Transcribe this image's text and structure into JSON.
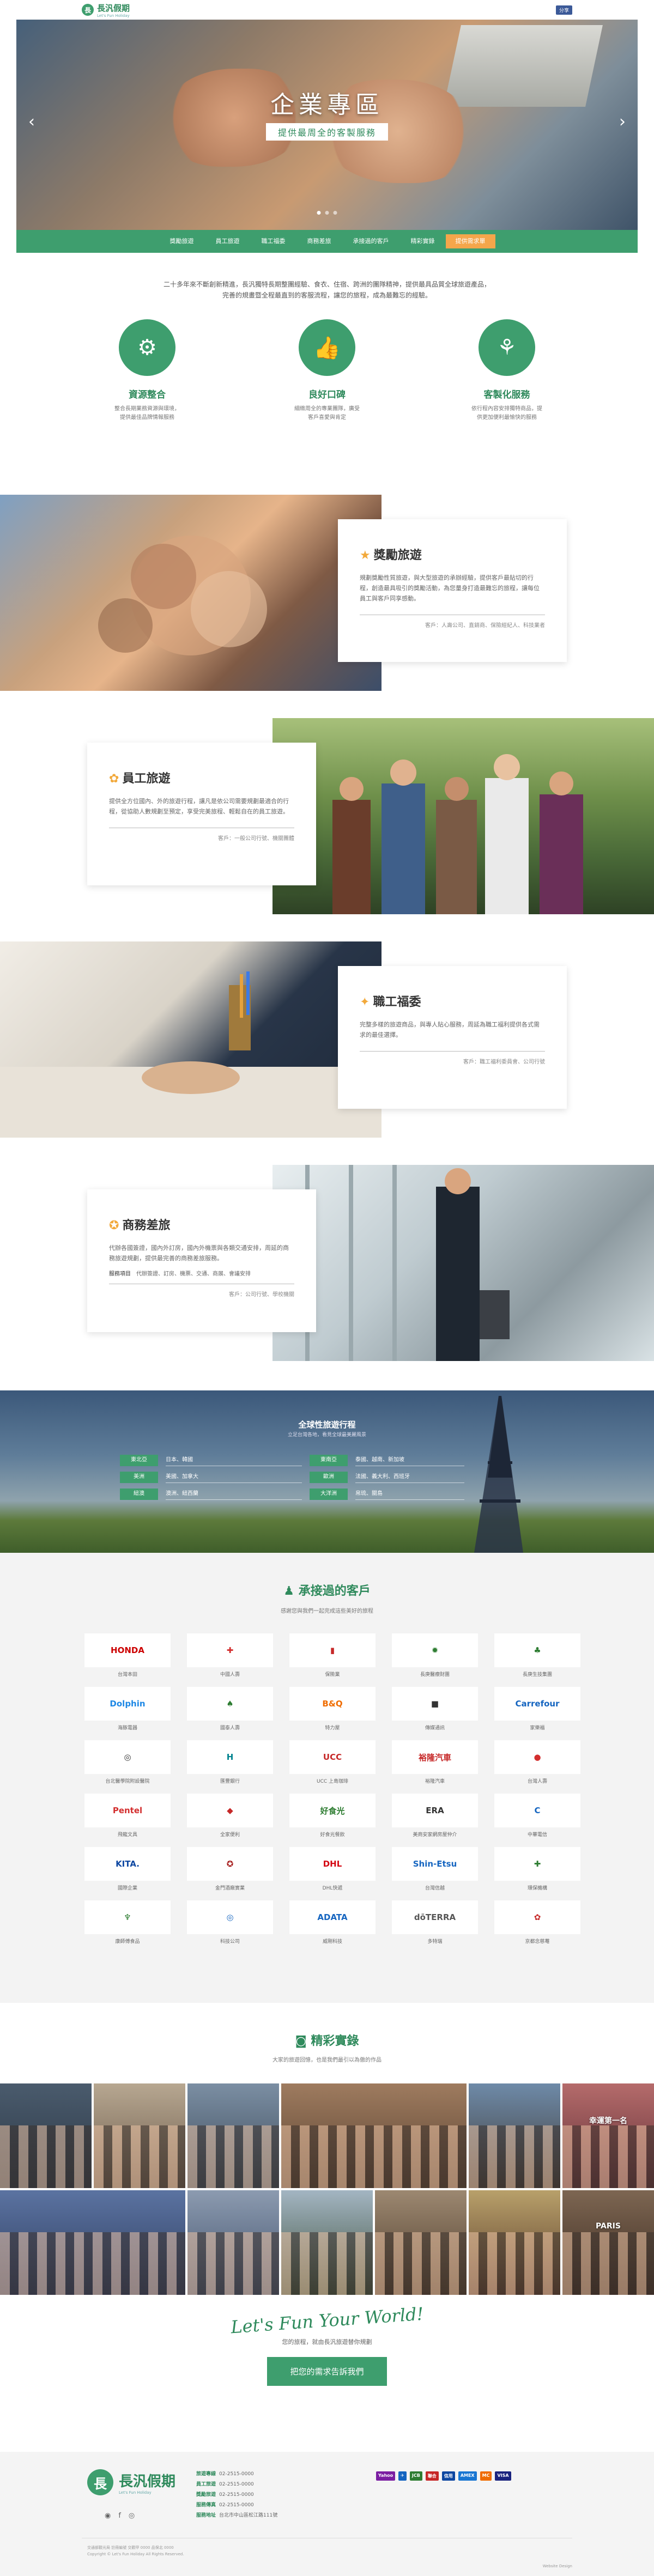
{
  "header": {
    "logo_text": "長汎假期",
    "logo_sub": "Let's Fun Holiday",
    "share_label": "分享"
  },
  "hero": {
    "title": "企業專區",
    "subtitle": "提供最周全的客製服務",
    "prev": "‹",
    "next": "›"
  },
  "nav": {
    "items": [
      "獎勵旅遊",
      "員工旅遊",
      "職工福委",
      "商務差旅",
      "承接過的客戶",
      "精彩實錄",
      "提供需求單"
    ]
  },
  "intro": {
    "line1": "二十多年來不斷創新精進，長汎獨特長期整團經驗、食衣、住宿、跨洲的團隊精神，提供最具品質全球旅遊產品，",
    "line2": "完善的規畫暨全程最直到的客服流程，讓您的旅程，成為最難忘的經驗。"
  },
  "features": [
    {
      "icon": "network-icon",
      "glyph": "⚙",
      "title": "資源整合",
      "line1": "整合長期業務資源與環境，",
      "line2": "提供最佳品牌情報服務"
    },
    {
      "icon": "thumbs-up-icon",
      "glyph": "👍",
      "title": "良好口碑",
      "line1": "細緻周全的專業團隊，廣受",
      "line2": "客戶喜愛與肯定"
    },
    {
      "icon": "people-icon",
      "glyph": "⚘",
      "title": "客製化服務",
      "line1": "依行程內容安排獨特商品，提",
      "line2": "供更加便利最愉快的服務"
    }
  ],
  "services": [
    {
      "icon": "★",
      "title": "獎勵旅遊",
      "desc": "規劃獎勵性質旅遊，與大型旅遊的承辦經驗，提供客戶最貼切的行程，創造最具吸引的獎勵活動，為您量身打造最難忘的旅程，讓每位員工與客戶同享感動。",
      "note": "客戶：人壽公司、直銷商、保險經紀人、科技業者"
    },
    {
      "icon": "✿",
      "title": "員工旅遊",
      "desc": "提供全方位國內、外的旅遊行程，讓凡是依公司需要規劃最適合的行程，從協助人數規劃至預定，享受完美旅程、輕鬆自在的員工旅遊。",
      "note": "客戶：一般公司行號、機關團體"
    },
    {
      "icon": "✦",
      "title": "職工福委",
      "desc": "完整多樣的旅遊商品，與專人貼心服務，周延為職工福利提供各式需求的最佳選擇。",
      "note": "客戶：職工福利委員會、公司行號"
    },
    {
      "icon": "✪",
      "title": "商務差旅",
      "desc": "代辦各國簽證，國內外訂房，國內外機票與各類交通安排，周延的商務旅遊規劃，提供最完善的商務差旅服務。",
      "note_label": "服務項目",
      "note_items": "代辦簽證、訂房、機票、交通、商展、會議安排",
      "note": "客戶：公司行號、學校機關"
    }
  ],
  "travel": {
    "title": "全球性旅遊行程",
    "subtitle": "立足台灣各地，看見全球最美麗風景",
    "regions": [
      {
        "label": "東北亞",
        "text": "日本、韓國"
      },
      {
        "label": "東南亞",
        "text": "泰國、越南、新加坡"
      },
      {
        "label": "美洲",
        "text": "美國、加拿大"
      },
      {
        "label": "歐洲",
        "text": "法國、義大利、西班牙"
      },
      {
        "label": "紐澳",
        "text": "澳洲、紐西蘭"
      },
      {
        "label": "大洋洲",
        "text": "帛琉、關島"
      }
    ]
  },
  "clients": {
    "title": "承接過的客戶",
    "subtitle": "感謝您與我們一起完成這些美好的旅程",
    "items": [
      {
        "logo": "HONDA",
        "color": "#cc0000",
        "name": "台灣本田"
      },
      {
        "logo": "✚",
        "color": "#d32f2f",
        "name": "中國人壽"
      },
      {
        "logo": "▮",
        "color": "#c62828",
        "name": "保險業"
      },
      {
        "logo": "✹",
        "color": "#2e7d32",
        "name": "長庚醫療財團"
      },
      {
        "logo": "♣",
        "color": "#2e7d32",
        "name": "長庚生技集團"
      },
      {
        "logo": "Dolphin",
        "color": "#1e88e5",
        "name": "海豚電器"
      },
      {
        "logo": "♠",
        "color": "#2e7d32",
        "name": "國泰人壽"
      },
      {
        "logo": "B&Q",
        "color": "#ef6c00",
        "name": "特力屋"
      },
      {
        "logo": "■",
        "color": "#333333",
        "name": "傳媒通訊"
      },
      {
        "logo": "Carrefour",
        "color": "#1565c0",
        "name": "家樂福"
      },
      {
        "logo": "◎",
        "color": "#333333",
        "name": "台北醫學院附設醫院"
      },
      {
        "logo": "H",
        "color": "#00838f",
        "name": "匯豐銀行"
      },
      {
        "logo": "UCC",
        "color": "#c62828",
        "name": "UCC 上島珈琲"
      },
      {
        "logo": "裕隆汽車",
        "color": "#c62828",
        "name": "裕隆汽車"
      },
      {
        "logo": "●",
        "color": "#d32f2f",
        "name": "台灣人壽"
      },
      {
        "logo": "Pentel",
        "color": "#d32f2f",
        "name": "飛龍文具"
      },
      {
        "logo": "◆",
        "color": "#c62828",
        "name": "全家便利"
      },
      {
        "logo": "好食光",
        "color": "#2e7d32",
        "name": "好食光餐飲"
      },
      {
        "logo": "ERA",
        "color": "#333333",
        "name": "美商安家網房屋仲介"
      },
      {
        "logo": "C",
        "color": "#1565c0",
        "name": "中華電信"
      },
      {
        "logo": "KITA.",
        "color": "#0d47a1",
        "name": "國際企業"
      },
      {
        "logo": "✪",
        "color": "#a31515",
        "name": "金門酒廠實業"
      },
      {
        "logo": "DHL",
        "color": "#d40511",
        "name": "DHL快遞"
      },
      {
        "logo": "Shin-Etsu",
        "color": "#1565c0",
        "name": "台灣信越"
      },
      {
        "logo": "✚",
        "color": "#2e7d32",
        "name": "環保機構"
      },
      {
        "logo": "♆",
        "color": "#2e7d32",
        "name": "康師傅食品"
      },
      {
        "logo": "◎",
        "color": "#1565c0",
        "name": "科技公司"
      },
      {
        "logo": "ADATA",
        "color": "#1565c0",
        "name": "威剛科技"
      },
      {
        "logo": "dōTERRA",
        "color": "#555555",
        "name": "多特瑞"
      },
      {
        "logo": "✿",
        "color": "#c62828",
        "name": "京都念慈菴"
      }
    ]
  },
  "gallery": {
    "title": "精彩實錄",
    "subtitle": "大家的旅遊回憶，也是我們最引以為傲的作品",
    "items": [
      {
        "sky": "#4a5b6d",
        "ground": "#2c3744",
        "tag": ""
      },
      {
        "sky": "#b7a791",
        "ground": "#6b5a4a",
        "tag": ""
      },
      {
        "sky": "#7b8ea3",
        "ground": "#3c4a58",
        "tag": ""
      },
      {
        "sky": "#9e7b5f",
        "ground": "#5a4230",
        "tag": ""
      },
      {
        "sky": "#6e8aa8",
        "ground": "#403a35",
        "tag": ""
      },
      {
        "sky": "#b56b6b",
        "ground": "#5e2f35",
        "tag": "幸運第一名"
      },
      {
        "sky": "#5b73a1",
        "ground": "#2e3c5e",
        "tag": ""
      },
      {
        "sky": "#8c9bb0",
        "ground": "#41506b",
        "tag": ""
      },
      {
        "sky": "#a3b5c2",
        "ground": "#3d4f3a",
        "tag": ""
      },
      {
        "sky": "#9c8871",
        "ground": "#4e3b2a",
        "tag": ""
      },
      {
        "sky": "#b8a06a",
        "ground": "#583a2a",
        "tag": ""
      },
      {
        "sky": "#7d6652",
        "ground": "#3b2a20",
        "tag": "PARIS"
      },
      {
        "sky": "#a9c0b2",
        "ground": "#4a6a3f",
        "tag": ""
      }
    ]
  },
  "cta": {
    "script": "Let's Fun Your World!",
    "line1": "您的旅程，就由長汎旅遊替你規劃",
    "line2": "",
    "button": "把您的需求告訴我們"
  },
  "footer": {
    "logo_text": "長汎假期",
    "logo_sub": "Let's Fun Holiday",
    "contacts": [
      {
        "label": "旅遊專線",
        "value": "02-2515-0000"
      },
      {
        "label": "員工旅遊",
        "value": "02-2515-0000"
      },
      {
        "label": "獎勵旅遊",
        "value": "02-2515-0000"
      },
      {
        "label": "服務傳真",
        "value": "02-2515-0000"
      },
      {
        "label": "服務地址",
        "value": "台北市中山區松江路111號"
      }
    ],
    "payments": [
      {
        "label": "Yahoo",
        "color": "#7b1fa2"
      },
      {
        "label": "✈",
        "color": "#1565c0"
      },
      {
        "label": "JCB",
        "color": "#2e7d32"
      },
      {
        "label": "聯合",
        "color": "#c62828"
      },
      {
        "label": "信用",
        "color": "#0d47a1"
      },
      {
        "label": "AMEX",
        "color": "#1976d2"
      },
      {
        "label": "MC",
        "color": "#ef6c00"
      },
      {
        "label": "VISA",
        "color": "#1a237e"
      }
    ],
    "legal1": "交通部觀光局 註冊編號 交觀甲 0000 品保北 0000",
    "legal2": "Copyright © Let's Fun Holiday All Rights Reserved.",
    "legal3": "",
    "credit": "Website Design"
  }
}
